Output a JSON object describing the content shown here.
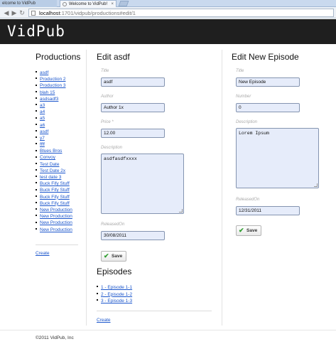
{
  "browser": {
    "tabs": [
      {
        "label": "elcome to VidPub"
      },
      {
        "label": "Welcome to VidPub!"
      }
    ],
    "tab_close": "×",
    "url_host": "localhost",
    "url_path": ":1701/vidpub/productions#edit/1",
    "back": "◀",
    "forward": "▶",
    "reload": "↻"
  },
  "header": {
    "logo": "VidPub"
  },
  "productions": {
    "title": "Productions",
    "items": [
      "asdf",
      "Production 2",
      "Production 3",
      "blah 15",
      "asdsadf3",
      "a3",
      "a4",
      "a5",
      "a6",
      "asdf",
      "y7",
      "ffff",
      "Blues Bros",
      "Convoy",
      "Test Date",
      "Test Date 2x",
      "test date 3",
      "Buck Fify Stuff",
      "Buck Fify Stuff",
      "Buck Fify Stuff",
      "Buck Fify Stuff",
      "New Production",
      "New Production",
      "New Production",
      "New Production"
    ],
    "create_link": "Create"
  },
  "edit": {
    "title": "Edit asdf",
    "fields": {
      "title_label": "Title",
      "title_value": "asdf",
      "author_label": "Author",
      "author_value": "Author 1x",
      "price_label": "Price *",
      "price_value": "12.00",
      "description_label": "Description",
      "description_value": "asdfasdfxxxx",
      "released_label": "ReleasedOn",
      "released_value": "30/08/2011"
    },
    "save_label": "Save"
  },
  "episodes": {
    "title": "Episodes",
    "items": [
      "1 - Episode 1-1",
      "2 - Episode 1-2",
      "3 - Episode 1-3"
    ],
    "create_link": "Create"
  },
  "new_episode": {
    "title": "Edit New Episode",
    "fields": {
      "title_label": "Title",
      "title_value": "New Episode",
      "number_label": "Number",
      "number_value": "0",
      "description_label": "Description",
      "description_value": "Lorem Ipsum",
      "released_label": "ReleasedOn",
      "released_value": "12/31/2011"
    },
    "save_label": "Save"
  },
  "footer": {
    "copyright": "©2011 VidPub, Inc"
  },
  "colors": {
    "header_bg": "#1f1f1f",
    "link": "#1a55cc",
    "input_bg": "#e6ecfa",
    "save_check": "#2e9e2e"
  }
}
